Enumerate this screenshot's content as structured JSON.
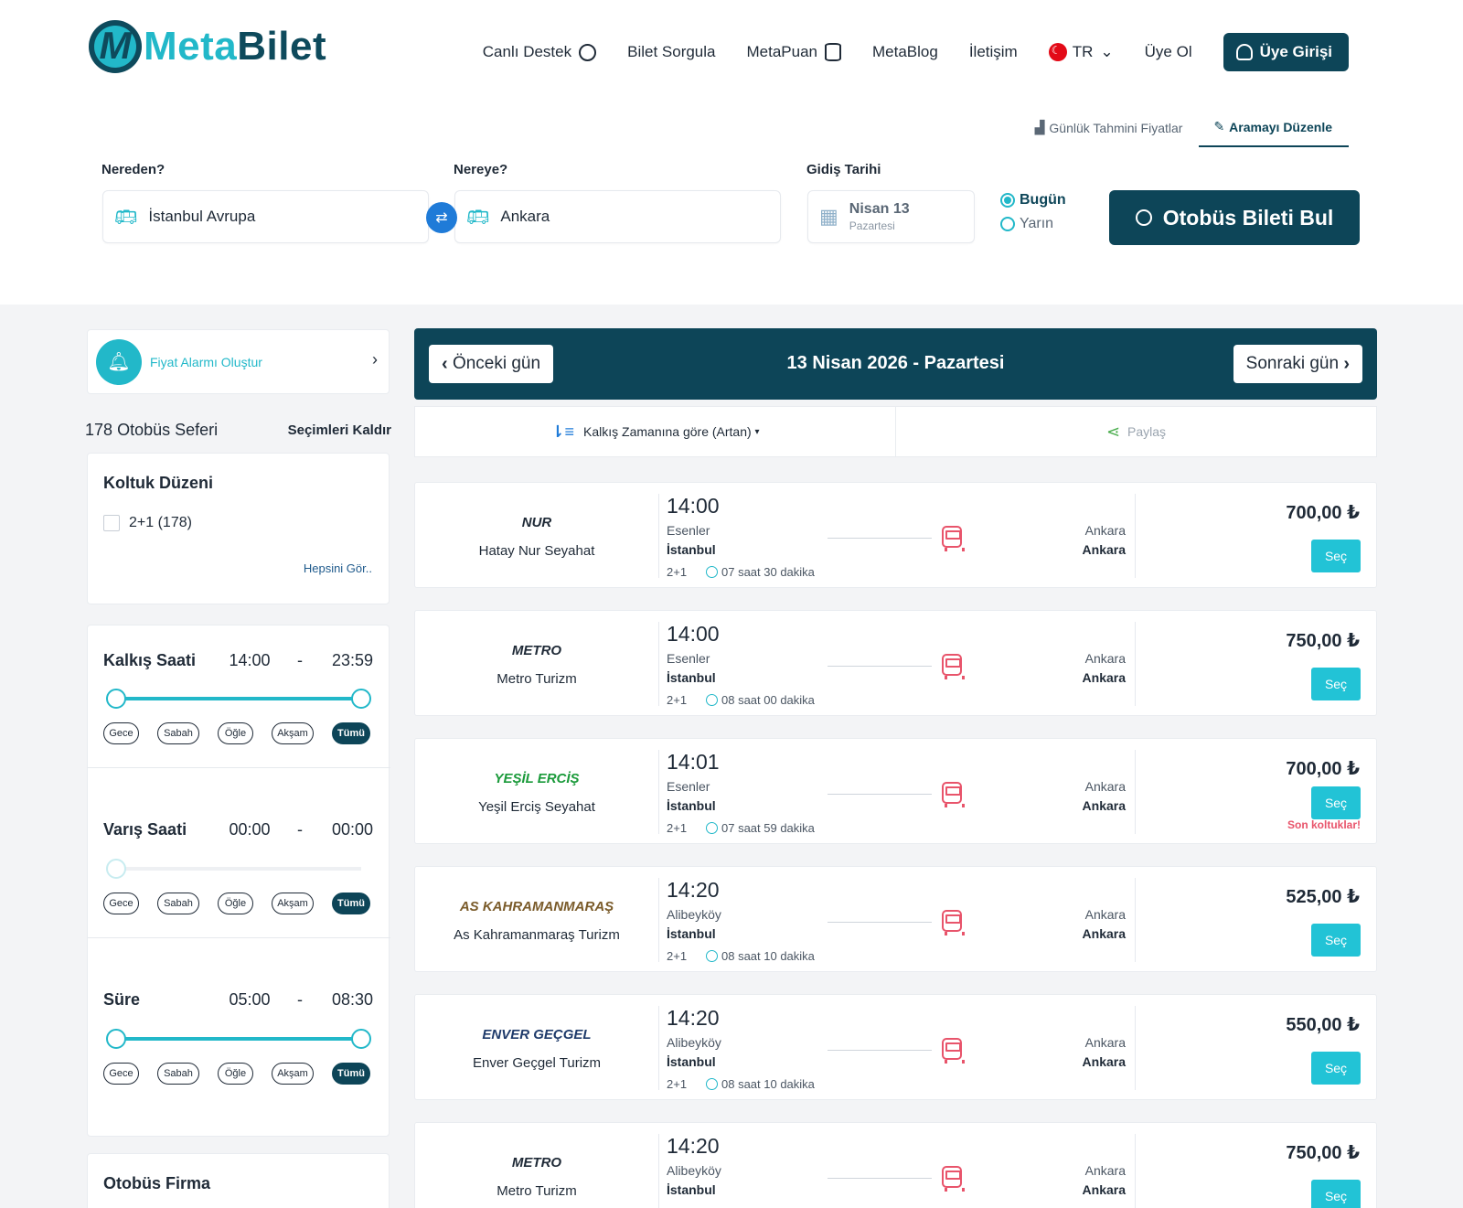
{
  "brand": {
    "meta": "Meta",
    "bilet": "Bilet",
    "mark": "M"
  },
  "nav": {
    "live_support": "Canlı Destek",
    "ticket_query": "Bilet Sorgula",
    "metapuan": "MetaPuan",
    "metablog": "MetaBlog",
    "contact": "İletişim",
    "language": "TR",
    "signup": "Üye Ol",
    "login": "Üye Girişi"
  },
  "search": {
    "tabs": {
      "daily_prices": "Günlük Tahmini Fiyatlar",
      "edit_search": "Aramayı Düzenle"
    },
    "from_label": "Nereden?",
    "from_value": "İstanbul Avrupa",
    "to_label": "Nereye?",
    "to_value": "Ankara",
    "date_label": "Gidiş Tarihi",
    "date_main": "Nisan 13",
    "date_sub": "Pazartesi",
    "today": "Bugün",
    "tomorrow": "Yarın",
    "find_button": "Otobüs Bileti Bul"
  },
  "sidebar": {
    "alarm": "Fiyat Alarmı Oluştur",
    "count_number": "178",
    "count_label": "Otobüs Seferi",
    "clear": "Seçimleri Kaldır",
    "seat_layout": {
      "title": "Koltuk Düzeni",
      "option": "2+1 (178)",
      "see_all": "Hepsini Gör.."
    },
    "chips": [
      "Gece",
      "Sabah",
      "Öğle",
      "Akşam",
      "Tümü"
    ],
    "departure": {
      "title": "Kalkış Saati",
      "min": "14:00",
      "dash": "-",
      "max": "23:59"
    },
    "arrival": {
      "title": "Varış Saati",
      "min": "00:00",
      "dash": "-",
      "max": "00:00"
    },
    "duration": {
      "title": "Süre",
      "min": "05:00",
      "dash": "-",
      "max": "08:30"
    },
    "company": {
      "title": "Otobüs Firma"
    }
  },
  "results": {
    "prev_day": "Önceki gün",
    "next_day": "Sonraki gün",
    "date_title": "13 Nisan 2026 - Pazartesi",
    "sort_label": "Kalkış Zamanına göre (Artan)",
    "share_label": "Paylaş",
    "select_label": "Seç",
    "trips": [
      {
        "logo": "NUR",
        "company": "Hatay Nur Seyahat",
        "time": "14:00",
        "from_stop": "Esenler",
        "from_city": "İstanbul",
        "seat": "2+1",
        "duration": "07 saat 30 dakika",
        "to_stop": "Ankara",
        "to_city": "Ankara",
        "price": "700,00 ₺",
        "note": ""
      },
      {
        "logo": "METRO",
        "company": "Metro Turizm",
        "time": "14:00",
        "from_stop": "Esenler",
        "from_city": "İstanbul",
        "seat": "2+1",
        "duration": "08 saat 00 dakika",
        "to_stop": "Ankara",
        "to_city": "Ankara",
        "price": "750,00 ₺",
        "note": ""
      },
      {
        "logo": "YEŞİL ERCİŞ",
        "company": "Yeşil Erciş Seyahat",
        "time": "14:01",
        "from_stop": "Esenler",
        "from_city": "İstanbul",
        "seat": "2+1",
        "duration": "07 saat 59 dakika",
        "to_stop": "Ankara",
        "to_city": "Ankara",
        "price": "700,00 ₺",
        "note": "Son koltuklar!"
      },
      {
        "logo": "AS KAHRAMANMARAŞ",
        "company": "As Kahramanmaraş Turizm",
        "time": "14:20",
        "from_stop": "Alibeyköy",
        "from_city": "İstanbul",
        "seat": "2+1",
        "duration": "08 saat 10 dakika",
        "to_stop": "Ankara",
        "to_city": "Ankara",
        "price": "525,00 ₺",
        "note": ""
      },
      {
        "logo": "ENVER GEÇGEL",
        "company": "Enver Geçgel Turizm",
        "time": "14:20",
        "from_stop": "Alibeyköy",
        "from_city": "İstanbul",
        "seat": "2+1",
        "duration": "08 saat 10 dakika",
        "to_stop": "Ankara",
        "to_city": "Ankara",
        "price": "550,00 ₺",
        "note": ""
      },
      {
        "logo": "METRO",
        "company": "Metro Turizm",
        "time": "14:20",
        "from_stop": "Alibeyköy",
        "from_city": "İstanbul",
        "seat": "",
        "duration": "",
        "to_stop": "Ankara",
        "to_city": "Ankara",
        "price": "750,00 ₺",
        "note": ""
      }
    ]
  },
  "colors": {
    "primary": "#0d4558",
    "accent": "#22b8c9",
    "button": "#22c3d6",
    "warn": "#e8546b"
  }
}
